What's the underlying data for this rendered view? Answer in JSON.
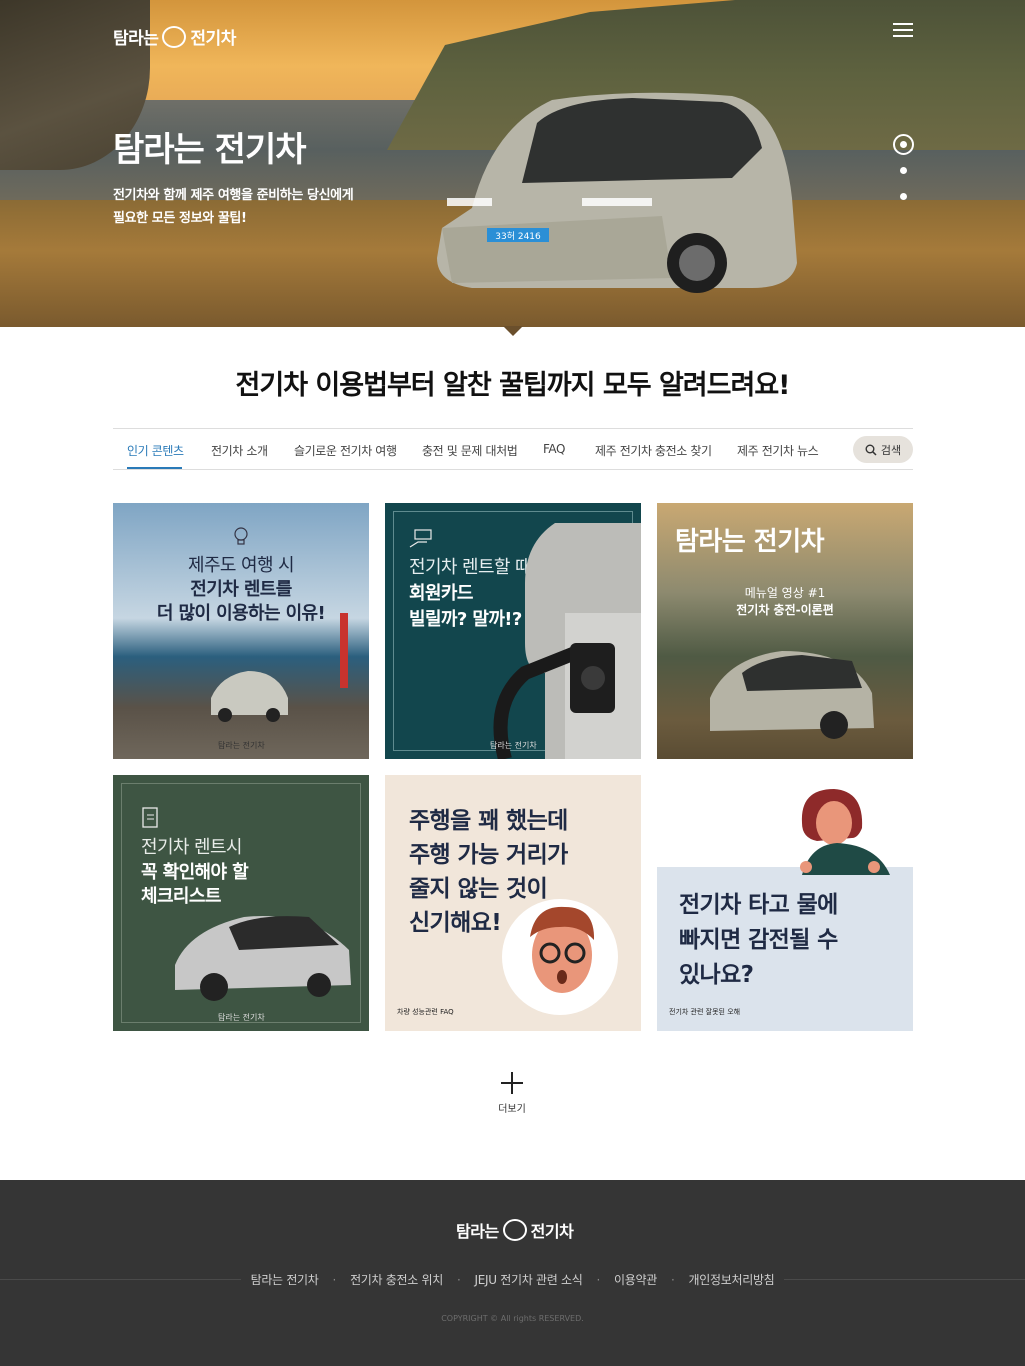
{
  "brand": {
    "logo_text_left": "탐라는",
    "logo_text_right": "전기차"
  },
  "hero": {
    "title": "탐라는 전기차",
    "subtitle_line1": "전기차와 함께 제주 여행을 준비하는 당신에게",
    "subtitle_line2": "필요한 모든 정보와 꿀팁!",
    "plate": "33허 2416",
    "slides": 3,
    "active_slide": 1
  },
  "section": {
    "title": "전기차 이용법부터 알찬 꿀팁까지 모두 알려드려요!"
  },
  "tabs": [
    {
      "label": "인기 콘텐츠",
      "active": true
    },
    {
      "label": "전기차 소개"
    },
    {
      "label": "슬기로운 전기차 여행"
    },
    {
      "label": "충전 및 문제 대처법"
    },
    {
      "label": "FAQ"
    },
    {
      "label": "제주 전기차 충전소 찾기"
    },
    {
      "label": "제주 전기차 뉴스"
    }
  ],
  "search": {
    "label": "검색"
  },
  "cards": [
    {
      "line1": "제주도 여행 시",
      "line2": "전기차 렌트를",
      "line3": "더 많이 이용하는 이유!",
      "foot": "탐라는 전기차",
      "bg": "#8fb0c9"
    },
    {
      "line1": "전기차 렌트할 때",
      "line2": "회원카드",
      "line3": "빌릴까? 말까!?",
      "foot": "탐라는 전기차",
      "bg": "#12464d"
    },
    {
      "line1": "메뉴얼 영상 #1",
      "line2": "전기차 충전-이론편",
      "logo": "탐라는 전기차",
      "bg": "#5d6649"
    },
    {
      "line1": "전기차 렌트시",
      "line2": "꼭 확인해야 할",
      "line3": "체크리스트",
      "foot": "탐라는 전기차",
      "bg": "#3e5543"
    },
    {
      "line1": "주행을 꽤 했는데",
      "line2": "주행 가능 거리가",
      "line3": "줄지 않는 것이",
      "line4": "신기해요!",
      "foot": "차량 성능관련 FAQ",
      "bg": "#f1e6da"
    },
    {
      "line1": "전기차 타고 물에",
      "line2": "빠지면 감전될 수",
      "line3": "있나요?",
      "foot": "전기차 관련 잘못된 오해",
      "bg": "#dbe3ec"
    }
  ],
  "more": {
    "label": "더보기"
  },
  "footer": {
    "nav": [
      "탐라는 전기차",
      "전기차 충전소 위치",
      "JEJU 전기차 관련 소식",
      "이용약관",
      "개인정보처리방침"
    ],
    "copyright": "COPYRIGHT © All rights RESERVED."
  },
  "colors": {
    "accent": "#2a7ab8",
    "footer_bg": "#353535",
    "navy_text": "#1f2a44"
  }
}
